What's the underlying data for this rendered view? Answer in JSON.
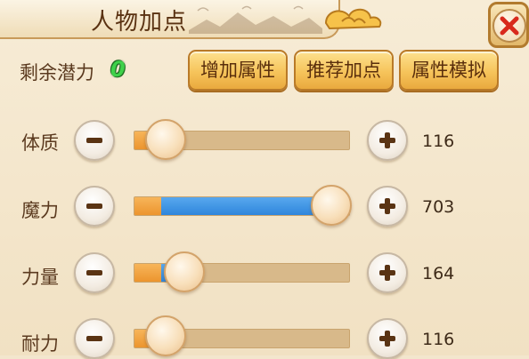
{
  "title": "人物加点",
  "potential": {
    "label": "剩余潜力",
    "value": "0"
  },
  "buttons": {
    "add": "增加属性",
    "recommend": "推荐加点",
    "simulate": "属性模拟"
  },
  "stats": [
    {
      "label": "体质",
      "value": "116",
      "allocated_fraction": 0.0
    },
    {
      "label": "魔力",
      "value": "703",
      "allocated_fraction": 1.0
    },
    {
      "label": "力量",
      "value": "164",
      "allocated_fraction": 0.1
    },
    {
      "label": "耐力",
      "value": "116",
      "allocated_fraction": 0.0
    }
  ],
  "colors": {
    "base_fill": "#ec952e",
    "allocated_fill": "#2f86dc",
    "potential_value": "#3fd14a",
    "close_x": "#d82a1c"
  },
  "icons": [
    "close-icon",
    "minus-icon",
    "plus-icon",
    "cloud-ornament-icon"
  ]
}
